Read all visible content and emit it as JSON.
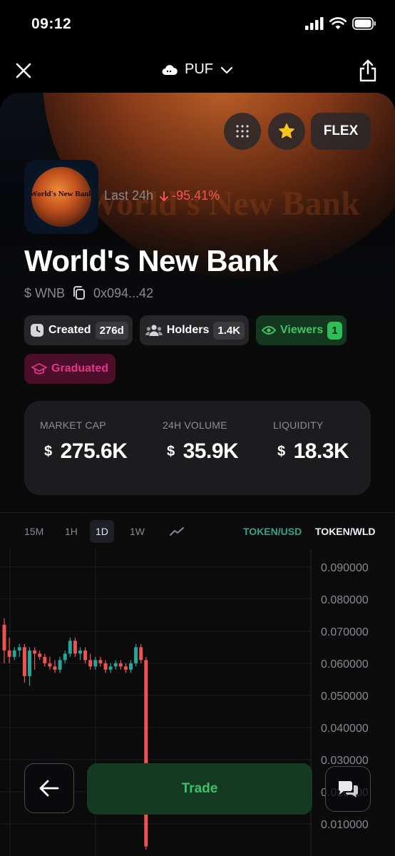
{
  "status_bar": {
    "time": "09:12",
    "icons": [
      "signal-icon",
      "wifi-icon",
      "battery-icon"
    ]
  },
  "nav": {
    "title": "PUF",
    "icons": [
      "close-icon",
      "cloud-icon",
      "chevron-down-icon",
      "share-icon"
    ]
  },
  "hero": {
    "flex_label": "FLEX",
    "logo_text": "World's New Bank",
    "watermark": "World's New Bank",
    "change_label": "Last 24h",
    "change_value": "-95.41%",
    "name": "World's New Bank",
    "ticker": "$ WNB",
    "address": "0x094...42"
  },
  "chips": {
    "created_label": "Created",
    "created_value": "276d",
    "holders_label": "Holders",
    "holders_value": "1.4K",
    "viewers_label": "Viewers",
    "viewers_value": "1",
    "graduated_label": "Graduated"
  },
  "stats": {
    "market_cap_label": "MARKET CAP",
    "market_cap_value": "275.6K",
    "volume_label": "24H VOLUME",
    "volume_value": "35.9K",
    "liquidity_label": "LIQUIDITY",
    "liquidity_value": "18.3K",
    "currency": "$"
  },
  "chart_controls": {
    "timeframes": [
      "15M",
      "1H",
      "1D",
      "1W"
    ],
    "active_timeframe": "1D",
    "pair_usd": "TOKEN/USD",
    "pair_wld": "TOKEN/WLD"
  },
  "chart_data": {
    "type": "candlestick",
    "y_ticks": [
      "0.090000",
      "0.080000",
      "0.070000",
      "0.060000",
      "0.050000",
      "0.040000",
      "0.030000",
      "0.020000",
      "0.010000"
    ],
    "ylim": [
      0.0,
      0.0955
    ],
    "candles": [
      {
        "o": 0.072,
        "h": 0.074,
        "l": 0.06,
        "c": 0.064
      },
      {
        "o": 0.064,
        "h": 0.068,
        "l": 0.06,
        "c": 0.062
      },
      {
        "o": 0.062,
        "h": 0.065,
        "l": 0.061,
        "c": 0.064
      },
      {
        "o": 0.064,
        "h": 0.066,
        "l": 0.062,
        "c": 0.065
      },
      {
        "o": 0.065,
        "h": 0.066,
        "l": 0.054,
        "c": 0.056
      },
      {
        "o": 0.056,
        "h": 0.065,
        "l": 0.053,
        "c": 0.064
      },
      {
        "o": 0.064,
        "h": 0.065,
        "l": 0.058,
        "c": 0.063
      },
      {
        "o": 0.063,
        "h": 0.064,
        "l": 0.061,
        "c": 0.062
      },
      {
        "o": 0.062,
        "h": 0.063,
        "l": 0.059,
        "c": 0.06
      },
      {
        "o": 0.06,
        "h": 0.062,
        "l": 0.058,
        "c": 0.059
      },
      {
        "o": 0.059,
        "h": 0.061,
        "l": 0.057,
        "c": 0.058
      },
      {
        "o": 0.058,
        "h": 0.062,
        "l": 0.057,
        "c": 0.061
      },
      {
        "o": 0.061,
        "h": 0.064,
        "l": 0.06,
        "c": 0.063
      },
      {
        "o": 0.063,
        "h": 0.068,
        "l": 0.062,
        "c": 0.067
      },
      {
        "o": 0.067,
        "h": 0.068,
        "l": 0.062,
        "c": 0.063
      },
      {
        "o": 0.063,
        "h": 0.065,
        "l": 0.061,
        "c": 0.064
      },
      {
        "o": 0.064,
        "h": 0.065,
        "l": 0.06,
        "c": 0.061
      },
      {
        "o": 0.061,
        "h": 0.063,
        "l": 0.058,
        "c": 0.059
      },
      {
        "o": 0.059,
        "h": 0.062,
        "l": 0.058,
        "c": 0.061
      },
      {
        "o": 0.061,
        "h": 0.062,
        "l": 0.059,
        "c": 0.06
      },
      {
        "o": 0.06,
        "h": 0.061,
        "l": 0.057,
        "c": 0.058
      },
      {
        "o": 0.058,
        "h": 0.06,
        "l": 0.057,
        "c": 0.059
      },
      {
        "o": 0.059,
        "h": 0.061,
        "l": 0.058,
        "c": 0.06
      },
      {
        "o": 0.06,
        "h": 0.061,
        "l": 0.058,
        "c": 0.059
      },
      {
        "o": 0.059,
        "h": 0.06,
        "l": 0.057,
        "c": 0.058
      },
      {
        "o": 0.058,
        "h": 0.061,
        "l": 0.057,
        "c": 0.06
      },
      {
        "o": 0.06,
        "h": 0.066,
        "l": 0.059,
        "c": 0.065
      },
      {
        "o": 0.065,
        "h": 0.066,
        "l": 0.06,
        "c": 0.061
      },
      {
        "o": 0.061,
        "h": 0.062,
        "l": 0.002,
        "c": 0.003
      }
    ],
    "up_color": "#26a69a",
    "down_color": "#ef5350"
  },
  "bottom_bar": {
    "trade_label": "Trade",
    "icons": [
      "arrow-left-icon",
      "chat-icon"
    ]
  },
  "colors": {
    "positive": "#3ec168",
    "negative": "#f05454",
    "pink": "#e0358b",
    "card": "#1c1c1e"
  }
}
